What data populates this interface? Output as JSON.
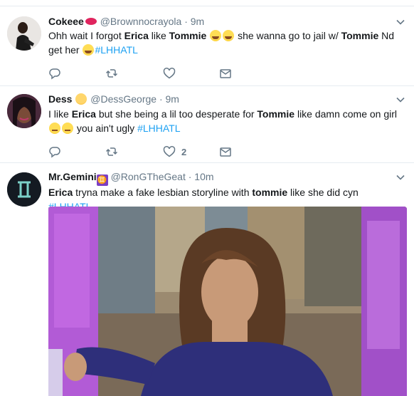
{
  "tweets": [
    {
      "name": "Cokeee",
      "handle": "@Brownnocrayola",
      "time": "9m",
      "text": {
        "p1": "Ohh wait I forgot ",
        "b1": "Erica",
        "p2": " like ",
        "b2": "Tommie",
        "p3": " she wanna go to jail w/ ",
        "b3": "Tommie",
        "p4": " Nd get her ",
        "tag": "#LHHATL"
      },
      "actions": {
        "reply_count": "",
        "retweet_count": "",
        "like_count": ""
      }
    },
    {
      "name": "Dess",
      "handle": "@DessGeorge",
      "time": "9m",
      "text": {
        "p1": "I like ",
        "b1": "Erica",
        "p2": " but she being a lil too desperate for ",
        "b2": "Tommie",
        "p3": " like damn come on girl ",
        "p4": " you ain't ugly ",
        "tag": "#LHHATL"
      },
      "actions": {
        "reply_count": "",
        "retweet_count": "",
        "like_count": "2"
      }
    },
    {
      "name": "Mr.Gemini",
      "handle": "@RonGTheGeat",
      "time": "10m",
      "text": {
        "b1": "Erica",
        "p1": " tryna make a fake lesbian storyline with ",
        "b2": "tommie",
        "p2": " like she did cyn ",
        "tag": "#LHHATL"
      },
      "gem_glyph": "♊"
    }
  ],
  "separator": "·",
  "colors": {
    "link": "#1da1f2",
    "secondary_text": "#657786",
    "border": "#e6ecf0",
    "primary_text": "#14171a"
  },
  "icons": [
    "reply-icon",
    "retweet-icon",
    "like-icon",
    "direct-message-icon",
    "caret-down-icon"
  ]
}
